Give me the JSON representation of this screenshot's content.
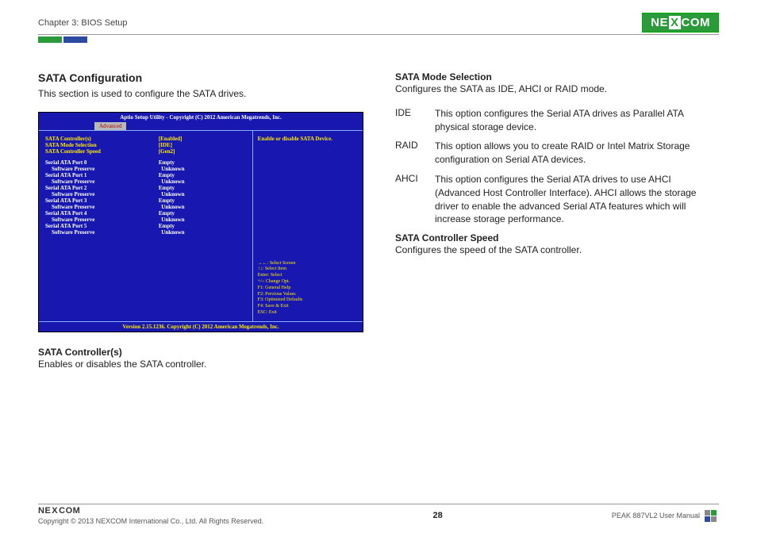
{
  "header": {
    "chapter": "Chapter 3: BIOS Setup",
    "logo_text": "NEXCOM"
  },
  "left": {
    "h2": "SATA Configuration",
    "intro": "This section is used to configure the SATA drives.",
    "controllers_h": "SATA Controller(s)",
    "controllers_p": "Enables or disables the SATA controller."
  },
  "bios": {
    "title": "Aptio Setup Utility - Copyright (C) 2012 American Megatrends, Inc.",
    "tab": "Advanced",
    "help": "Enable or disable SATA Device.",
    "keys": [
      "→←: Select Screen",
      "↑↓: Select Item",
      "Enter: Select",
      "+/-: Change Opt.",
      "F1: General Help",
      "F2: Previous Values",
      "F3: Optimized Defaults",
      "F4: Save & Exit",
      "ESC: Exit"
    ],
    "footer": "Version 2.15.1236. Copyright (C) 2012 American Megatrends, Inc.",
    "top_rows": [
      {
        "label": "SATA Controller(s)",
        "value": "[Enabled]",
        "cls": "yellow"
      },
      {
        "label": "SATA Mode Selection",
        "value": "[IDE]",
        "cls": "yellow"
      },
      {
        "label": "SATA Controller Speed",
        "value": "[Gen2]",
        "cls": "yellow"
      }
    ],
    "ports": [
      {
        "label": "Serial ATA Port 0",
        "value": "Empty"
      },
      {
        "label": "Software Preserve",
        "value": "Unknown",
        "indent": true
      },
      {
        "label": "Serial ATA Port 1",
        "value": "Empty"
      },
      {
        "label": "Software Preserve",
        "value": "Unknown",
        "indent": true
      },
      {
        "label": "Serial ATA Port 2",
        "value": "Empty"
      },
      {
        "label": "Software Preserve",
        "value": "Unknown",
        "indent": true
      },
      {
        "label": "Serial ATA Port 3",
        "value": "Empty"
      },
      {
        "label": "Software Preserve",
        "value": "Unknown",
        "indent": true
      },
      {
        "label": "Serial ATA Port 4",
        "value": "Empty"
      },
      {
        "label": "Software Preserve",
        "value": "Unknown",
        "indent": true
      },
      {
        "label": "Serial ATA Port 5",
        "value": "Empty"
      },
      {
        "label": "Software Preserve",
        "value": "Unknown",
        "indent": true
      }
    ]
  },
  "right": {
    "mode_h": "SATA Mode Selection",
    "mode_p": "Configures the SATA as IDE, AHCI or RAID mode.",
    "defs": [
      {
        "k": "IDE",
        "v": "This option configures the Serial ATA drives as Parallel ATA physical storage device."
      },
      {
        "k": "RAID",
        "v": "This option allows you to create RAID or Intel Matrix Storage configuration on Serial ATA devices."
      },
      {
        "k": "AHCI",
        "v": "This option configures the Serial ATA drives to use AHCI (Advanced Host Controller Interface). AHCI allows the storage driver to enable the advanced Serial ATA features which will increase storage performance."
      }
    ],
    "speed_h": "SATA Controller Speed",
    "speed_p": "Configures the speed of the SATA controller."
  },
  "footer": {
    "logo": "NEXCOM",
    "copyright": "Copyright © 2013 NEXCOM International Co., Ltd. All Rights Reserved.",
    "page": "28",
    "manual": "PEAK 887VL2 User Manual"
  }
}
